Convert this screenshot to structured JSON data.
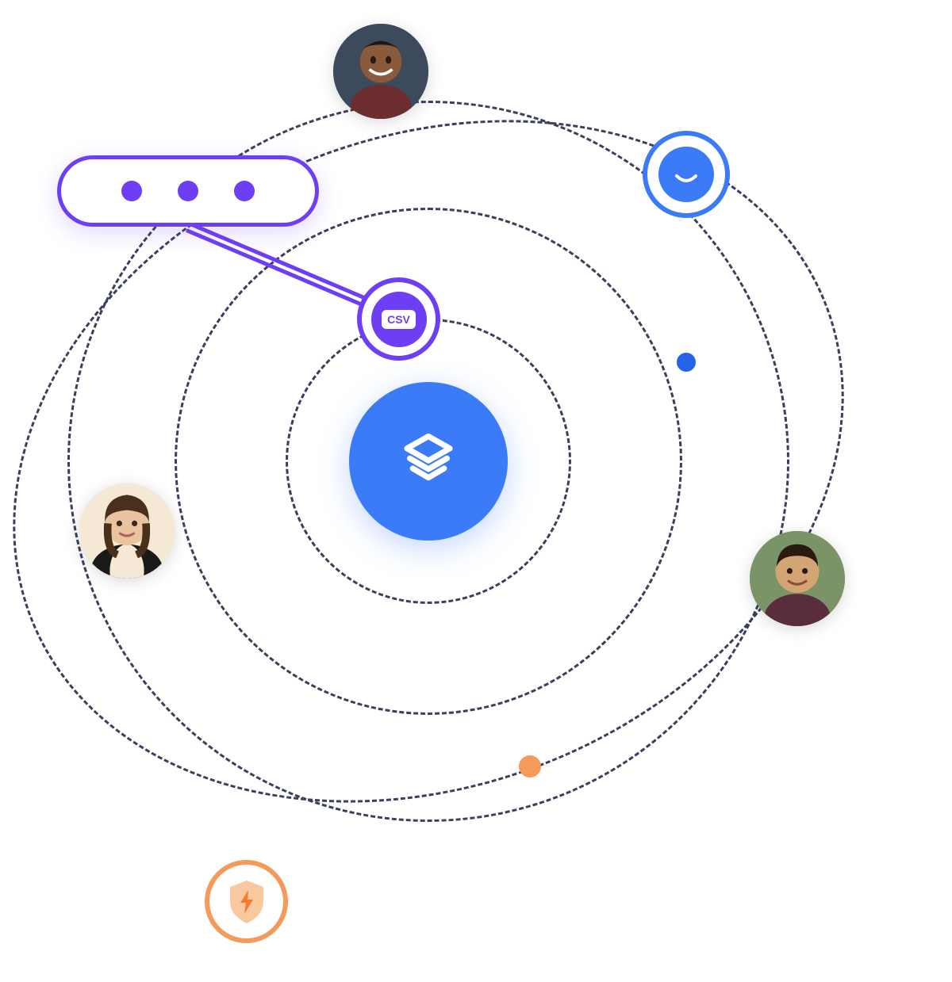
{
  "diagram": {
    "center_icon": "layers-logo-icon",
    "csv_label": "CSV",
    "nodes": [
      {
        "type": "avatar",
        "name": "avatar-person-1"
      },
      {
        "type": "avatar",
        "name": "avatar-person-2"
      },
      {
        "type": "avatar",
        "name": "avatar-person-3"
      },
      {
        "type": "chat",
        "name": "chat-smile-icon"
      },
      {
        "type": "csv",
        "name": "csv-file-icon"
      },
      {
        "type": "shield",
        "name": "shield-bolt-icon"
      },
      {
        "type": "dot",
        "name": "blue-dot"
      },
      {
        "type": "dot",
        "name": "orange-dot"
      },
      {
        "type": "ellipsis",
        "name": "ellipsis-pill"
      }
    ],
    "colors": {
      "primary_blue": "#3b7bf7",
      "purple": "#6e3ef4",
      "orange": "#f49a5b",
      "orbit_dash": "#3a3f5c"
    }
  }
}
